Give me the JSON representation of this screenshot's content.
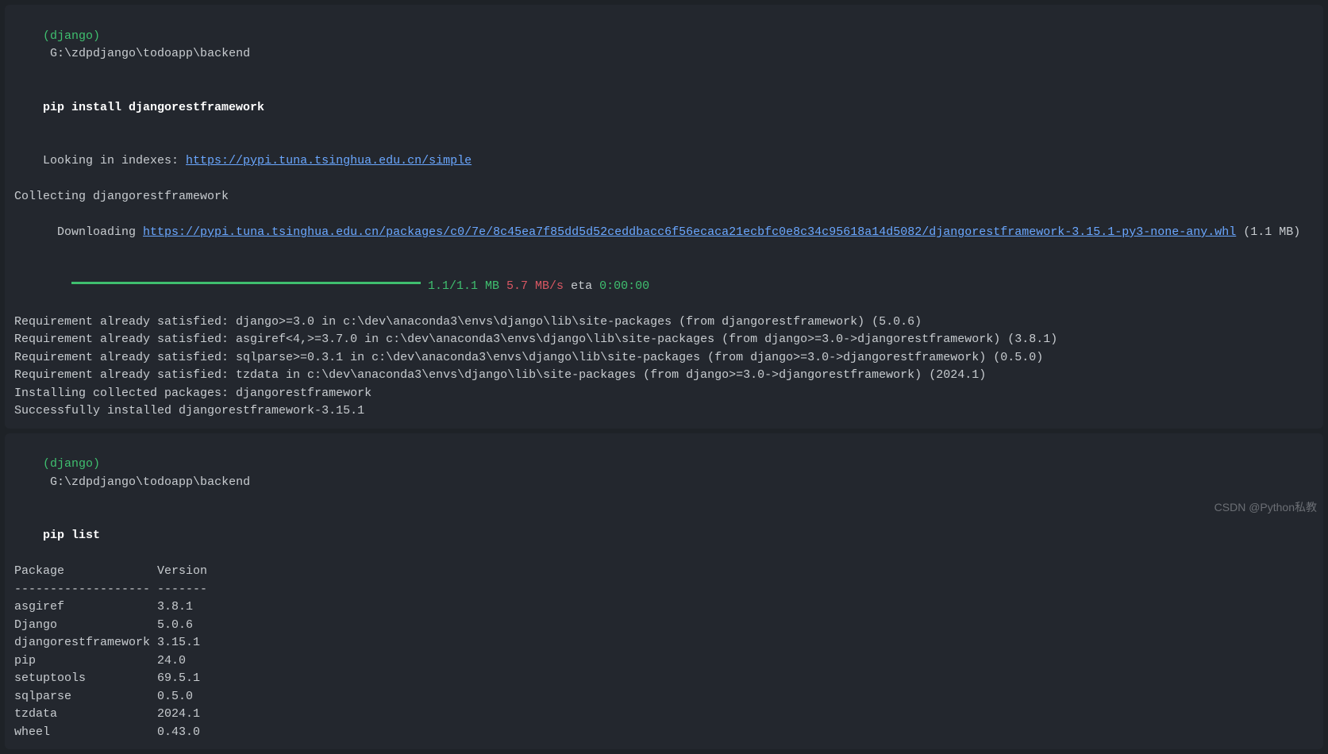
{
  "block1": {
    "env": "(django)",
    "path": "G:\\zdpdjango\\todoapp\\backend",
    "command": "pip install djangorestframework",
    "lookingPrefix": "Looking in indexes: ",
    "indexUrl": "https://pypi.tuna.tsinghua.edu.cn/simple",
    "collecting": "Collecting djangorestframework",
    "downloadingPrefix": "Downloading ",
    "downloadUrl": "https://pypi.tuna.tsinghua.edu.cn/packages/c0/7e/8c45ea7f85dd5d52ceddbacc6f56ecaca21ecbfc0e8c34c95618a14d5082/djangorestframework-3.15.1-py3-none-any.whl",
    "downloadSize": " (1.1 MB)",
    "progressRatio": " 1.1/1.1 MB",
    "progressSpeed": " 5.7 MB/s",
    "progressEtaLabel": " eta ",
    "progressEta": "0:00:00",
    "req1": "Requirement already satisfied: django>=3.0 in c:\\dev\\anaconda3\\envs\\django\\lib\\site-packages (from djangorestframework) (5.0.6)",
    "req2": "Requirement already satisfied: asgiref<4,>=3.7.0 in c:\\dev\\anaconda3\\envs\\django\\lib\\site-packages (from django>=3.0->djangorestframework) (3.8.1)",
    "req3": "Requirement already satisfied: sqlparse>=0.3.1 in c:\\dev\\anaconda3\\envs\\django\\lib\\site-packages (from django>=3.0->djangorestframework) (0.5.0)",
    "req4": "Requirement already satisfied: tzdata in c:\\dev\\anaconda3\\envs\\django\\lib\\site-packages (from django>=3.0->djangorestframework) (2024.1)",
    "installing": "Installing collected packages: djangorestframework",
    "success": "Successfully installed djangorestframework-3.15.1"
  },
  "block2": {
    "env": "(django)",
    "path": "G:\\zdpdjango\\todoapp\\backend",
    "command": "pip list",
    "header": "Package             Version",
    "divider": "------------------- -------",
    "packages": [
      {
        "name": "asgiref            ",
        "version": " 3.8.1"
      },
      {
        "name": "Django             ",
        "version": " 5.0.6"
      },
      {
        "name": "djangorestframework",
        "version": " 3.15.1"
      },
      {
        "name": "pip                ",
        "version": " 24.0"
      },
      {
        "name": "setuptools         ",
        "version": " 69.5.1"
      },
      {
        "name": "sqlparse           ",
        "version": " 0.5.0"
      },
      {
        "name": "tzdata             ",
        "version": " 2024.1"
      },
      {
        "name": "wheel              ",
        "version": " 0.43.0"
      }
    ]
  },
  "watermark": "CSDN @Python私教"
}
